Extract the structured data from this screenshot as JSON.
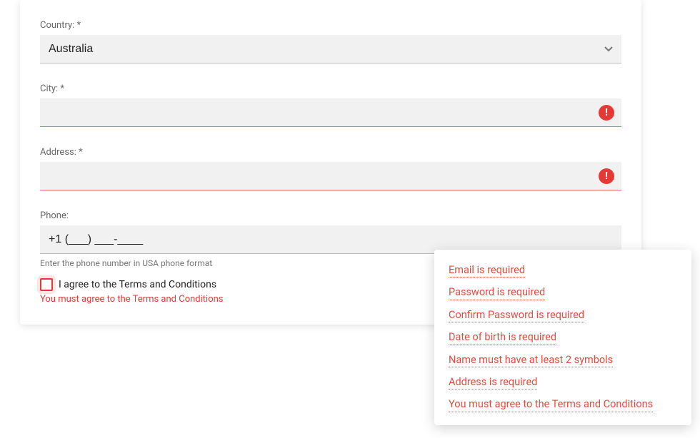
{
  "form": {
    "country": {
      "label": "Country: *",
      "value": "Australia"
    },
    "city": {
      "label": "City: *",
      "value": ""
    },
    "address": {
      "label": "Address: *",
      "value": ""
    },
    "phone": {
      "label": "Phone:",
      "value": "+1 (___) ___-____",
      "hint": "Enter the phone number in USA phone format"
    },
    "agree": {
      "label": "I agree to the Terms and Conditions",
      "error": "You must agree to the Terms and Conditions"
    }
  },
  "validation_summary": [
    "Email is required",
    "Password is required",
    "Confirm Password is required",
    "Date of birth is required",
    "Name must have at least 2 symbols",
    "Address is required",
    "You must agree to the Terms and Conditions"
  ],
  "colors": {
    "error": "#e53935",
    "error_text": "#e24c3f"
  }
}
